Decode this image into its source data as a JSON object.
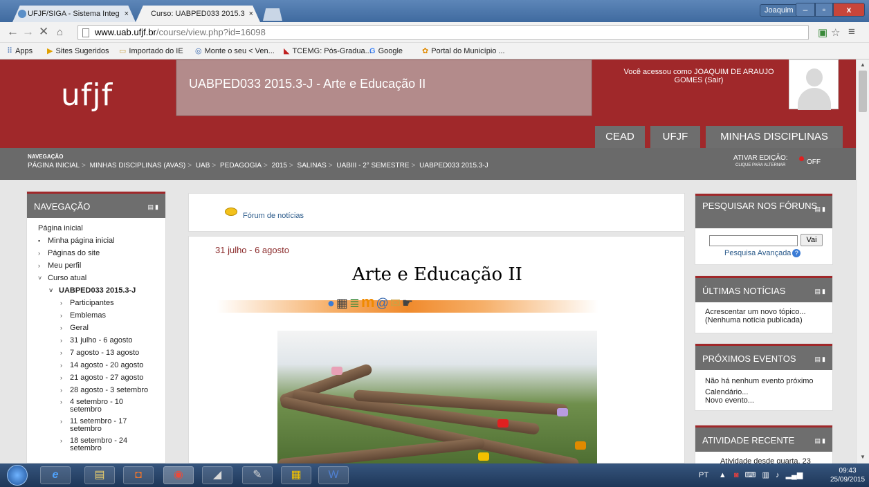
{
  "browser": {
    "tabs": [
      {
        "label": "UFJF/SIGA - Sistema Integ",
        "close": "×"
      },
      {
        "label": "Curso: UABPED033 2015.3",
        "close": "×"
      }
    ],
    "user_button": "Joaquim",
    "url_host": "www.uab.ufjf.br",
    "url_path": "/course/view.php?id=16098",
    "bookmarks": [
      "Apps",
      "Sites Sugeridos",
      "Importado do IE",
      "Monte o seu < Ven...",
      "TCEMG: Pós-Gradua...",
      "Google",
      "Portal do Município ..."
    ]
  },
  "header": {
    "logo": "ufjf",
    "course_title": "UABPED033 2015.3-J - Arte e Educação II",
    "user_info": "Você acessou como JOAQUIM DE ARAUJO GOMES (Sair)",
    "nav": [
      "CEAD",
      "UFJF",
      "MINHAS DISCIPLINAS"
    ]
  },
  "breadcrumb": {
    "label": "NAVEGAÇÃO",
    "items": [
      "PÁGINA INICIAL",
      "MINHAS DISCIPLINAS (AVAS)",
      "UAB",
      "PEDAGOGIA",
      "2015",
      "SALINAS",
      "UABIII - 2° SEMESTRE",
      "UABPED033 2015.3-J"
    ],
    "edit_label": "ATIVAR EDIÇÃO:",
    "edit_hint": "CLIQUE PARA ALTERNAR",
    "edit_state": "OFF"
  },
  "nav_block": {
    "title": "NAVEGAÇÃO",
    "items": [
      "Página inicial",
      "Minha página inicial",
      "Páginas do site",
      "Meu perfil",
      "Curso atual",
      "UABPED033 2015.3-J",
      "Participantes",
      "Emblemas",
      "Geral",
      "31 julho - 6 agosto",
      "7 agosto - 13 agosto",
      "14 agosto - 20 agosto",
      "21 agosto - 27 agosto",
      "28 agosto - 3 setembro",
      "4 setembro - 10",
      "setembro",
      "11 setembro - 17",
      "setembro",
      "18 setembro - 24",
      "setembro"
    ]
  },
  "main": {
    "forum_link": "Fórum de notícias",
    "week_title": "31 julho - 6 agosto",
    "banner_title": "Arte e Educação II"
  },
  "right": {
    "search_title": "PESQUISAR NOS FÓRUNS",
    "search_button": "Vai",
    "search_advanced": "Pesquisa Avançada",
    "news_title": "ÚLTIMAS NOTÍCIAS",
    "news_add": "Acrescentar um novo tópico...",
    "news_none": "(Nenhuma notícia publicada)",
    "events_title": "PRÓXIMOS EVENTOS",
    "events_none": "Não há nenhum evento próximo",
    "events_calendar": "Calendário...",
    "events_new": "Novo evento...",
    "activity_title": "ATIVIDADE RECENTE",
    "activity_text": "Atividade desde quarta, 23"
  },
  "taskbar": {
    "lang": "PT",
    "time": "09:43",
    "date": "25/09/2015"
  }
}
